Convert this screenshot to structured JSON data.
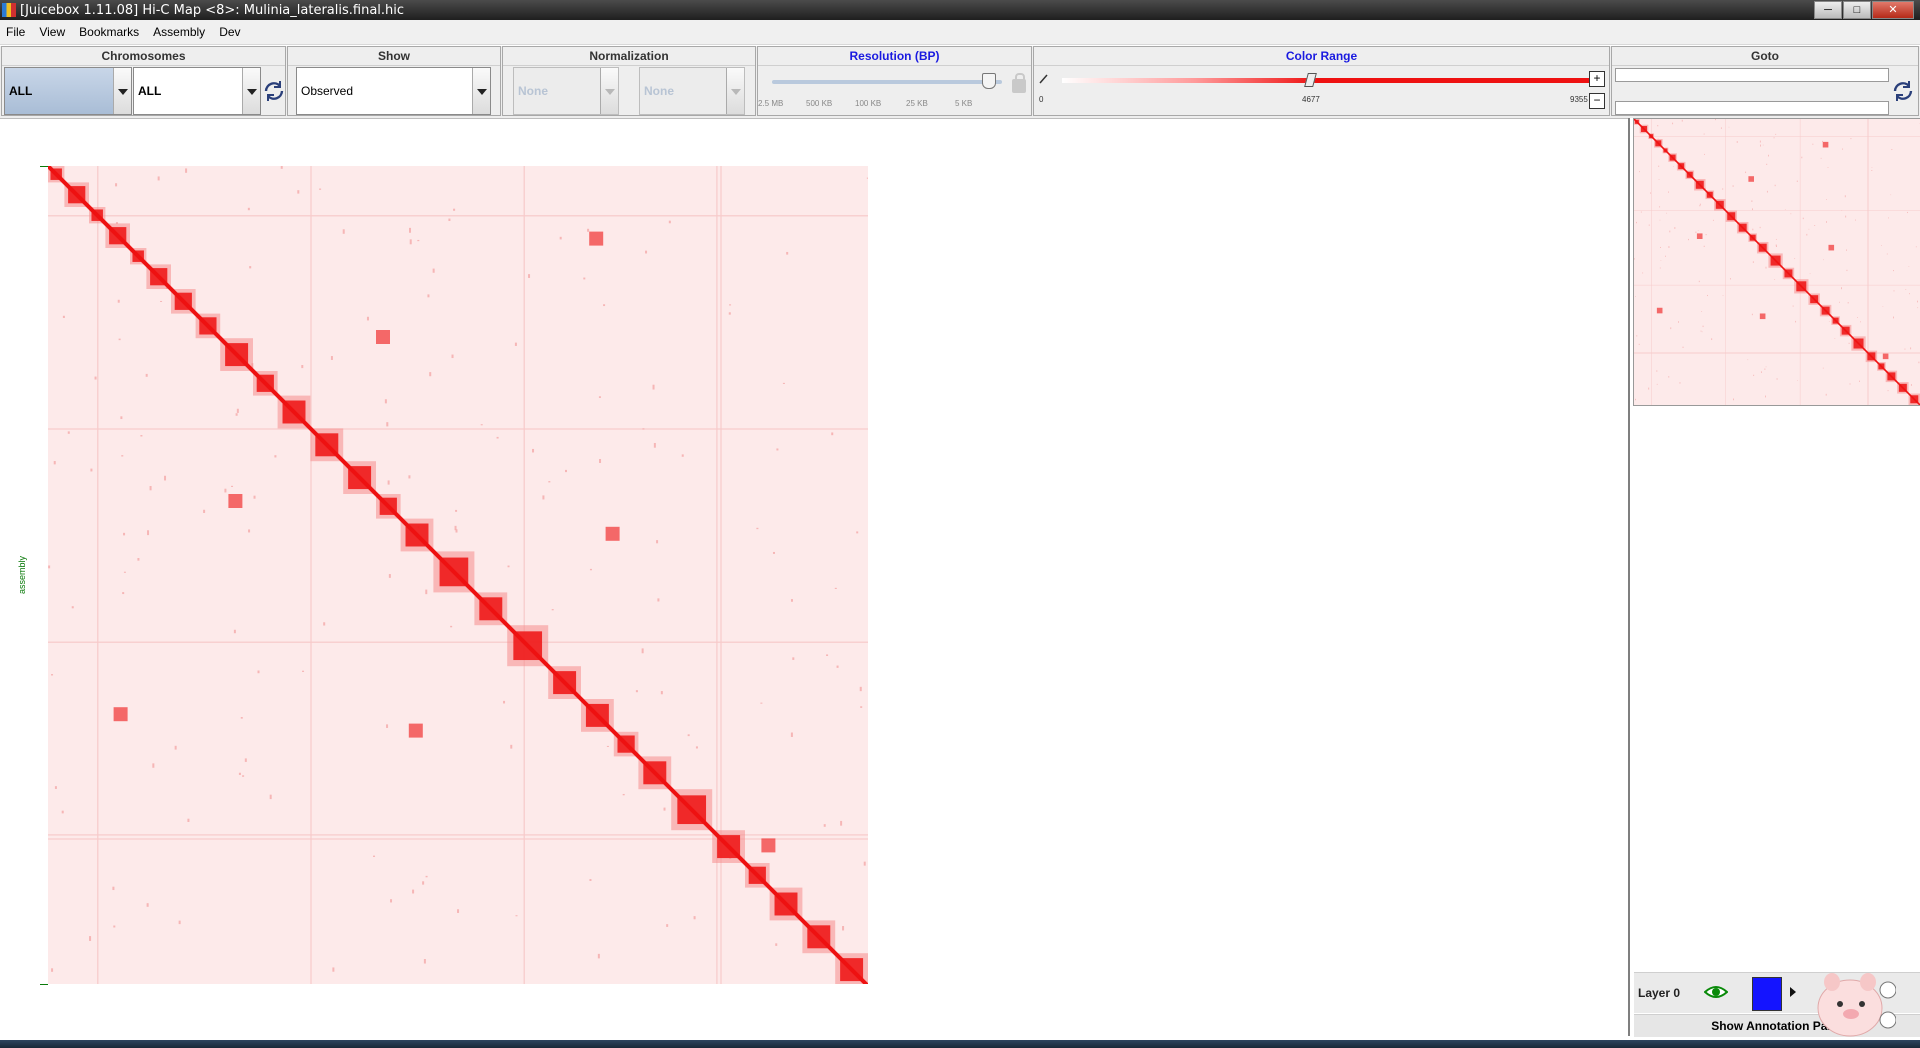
{
  "window": {
    "title": "[Juicebox 1.11.08] Hi-C Map <8>: Mulinia_lateralis.final.hic",
    "minimize_label": "─",
    "maximize_label": "□",
    "close_label": "✕"
  },
  "menu": [
    "File",
    "View",
    "Bookmarks",
    "Assembly",
    "Dev"
  ],
  "toolbar": {
    "chromosomes": {
      "label": "Chromosomes",
      "x_value": "ALL",
      "y_value": "ALL"
    },
    "show": {
      "label": "Show",
      "value": "Observed"
    },
    "normalization": {
      "label": "Normalization",
      "value1": "None",
      "value2": "None"
    },
    "resolution": {
      "label": "Resolution (BP)",
      "ticks": [
        "2.5 MB",
        "500 KB",
        "100 KB",
        "25 KB",
        "5 KB"
      ]
    },
    "color_range": {
      "label": "Color Range",
      "min": "0",
      "mid": "4677",
      "max": "9355",
      "plus": "+",
      "minus": "−"
    },
    "goto": {
      "label": "Goto"
    }
  },
  "map": {
    "axis_label": "assembly",
    "heat_color": "#ee1111"
  },
  "layers": {
    "layer_label": "Layer 0",
    "layer_color": "#1414ff",
    "annotation_button": "Show Annotation Panel"
  }
}
